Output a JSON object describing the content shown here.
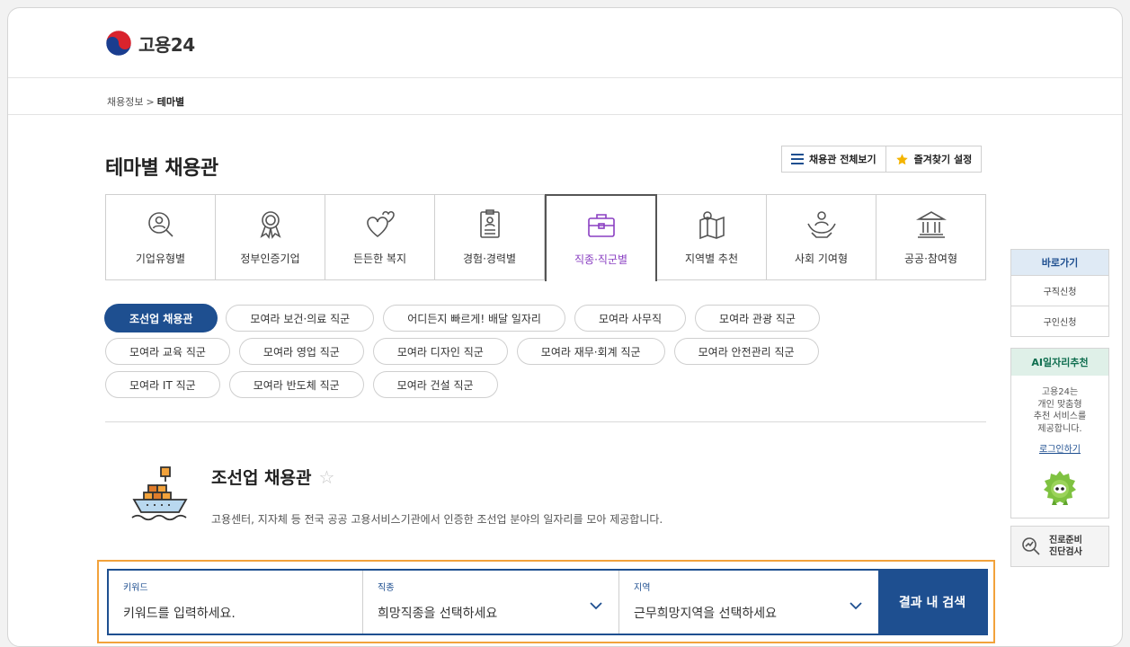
{
  "header": {
    "logo_text": "고용24"
  },
  "breadcrumb": {
    "parent": "채용정보",
    "separator": ">",
    "current": "테마별"
  },
  "page": {
    "title": "테마별 채용관"
  },
  "top_buttons": {
    "view_all": "채용관 전체보기",
    "favorites": "즐겨찾기 설정"
  },
  "tabs": [
    {
      "label": "기업유형별",
      "icon": "magnifier-person-icon"
    },
    {
      "label": "정부인증기업",
      "icon": "award-ribbon-icon"
    },
    {
      "label": "든든한 복지",
      "icon": "hearts-icon"
    },
    {
      "label": "경험·경력별",
      "icon": "id-card-icon"
    },
    {
      "label": "직종·직군별",
      "icon": "briefcase-icon",
      "active": true
    },
    {
      "label": "지역별 추천",
      "icon": "map-pin-icon"
    },
    {
      "label": "사회 기여형",
      "icon": "hands-people-icon"
    },
    {
      "label": "공공·참여형",
      "icon": "government-building-icon"
    }
  ],
  "chips": {
    "row1": [
      "조선업 채용관",
      "모여라 보건·의료 직군",
      "어디든지 빠르게! 배달 일자리",
      "모여라 사무직",
      "모여라 관광 직군"
    ],
    "row2": [
      "모여라 교육 직군",
      "모여라 영업 직군",
      "모여라 디자인 직군",
      "모여라 재무·회계 직군",
      "모여라 안전관리 직군"
    ],
    "row3": [
      "모여라 IT 직군",
      "모여라 반도체 직군",
      "모여라 건설 직군"
    ]
  },
  "hall": {
    "title": "조선업 채용관",
    "star": "☆",
    "description": "고용센터, 지자체 등 전국 공공 고용서비스기관에서 인증한 조선업 분야의 일자리를 모아 제공합니다."
  },
  "search": {
    "keyword_label": "키워드",
    "keyword_placeholder": "키워드를 입력하세요.",
    "job_label": "직종",
    "job_value": "희망직종을 선택하세요",
    "area_label": "지역",
    "area_value": "근무희망지역을 선택하세요",
    "button": "결과 내 검색"
  },
  "rail": {
    "shortcut_title": "바로가기",
    "items": [
      "구직신청",
      "구인신청"
    ],
    "ai_title": "AI일자리추천",
    "ai_text": [
      "고용24는",
      "개인 맞춤형",
      "추천 서비스를",
      "제공합니다."
    ],
    "ai_login": "로그인하기",
    "career_text": [
      "진로준비",
      "진단검사"
    ]
  },
  "colors": {
    "primary": "#1e4f90",
    "active_tab_text": "#8a3fc2",
    "highlight_outline": "#f2a23b",
    "star": "#f4b400"
  }
}
